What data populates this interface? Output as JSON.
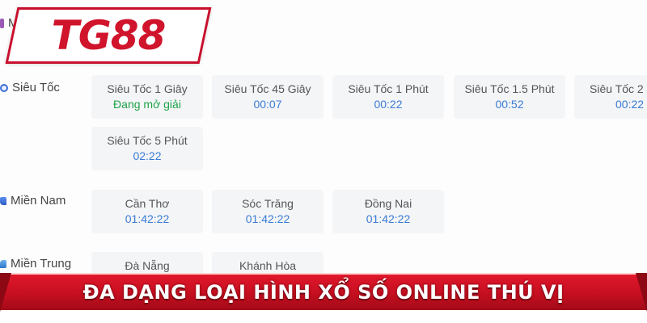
{
  "brand": {
    "logo_text": "TG88"
  },
  "categories": {
    "mega": {
      "label": "Me"
    },
    "sieu_toc": {
      "label": "Siêu Tốc",
      "games": [
        {
          "name": "Siêu Tốc 1 Giây",
          "status": "Đang mở giải"
        },
        {
          "name": "Siêu Tốc 45 Giây",
          "status": "00:07"
        },
        {
          "name": "Siêu Tốc 1 Phút",
          "status": "00:22"
        },
        {
          "name": "Siêu Tốc 1.5 Phút",
          "status": "00:52"
        },
        {
          "name": "Siêu Tốc 2",
          "status": "00:22"
        },
        {
          "name": "Siêu Tốc 5 Phút",
          "status": "02:22"
        }
      ]
    },
    "mien_nam": {
      "label": "Miền Nam",
      "games": [
        {
          "name": "Cần Thơ",
          "status": "01:42:22"
        },
        {
          "name": "Sóc Trăng",
          "status": "01:42:22"
        },
        {
          "name": "Đồng Nai",
          "status": "01:42:22"
        }
      ]
    },
    "mien_trung": {
      "label": "Miền Trung",
      "games": [
        {
          "name": "Đà Nẵng"
        },
        {
          "name": "Khánh Hòa"
        }
      ]
    }
  },
  "banner": {
    "text": "ĐA DẠNG LOẠI HÌNH XỔ SỐ ONLINE THÚ VỊ"
  },
  "colors": {
    "brand_red": "#d0142c",
    "countdown_blue": "#3a7bd5",
    "open_green": "#1fa34a",
    "tile_bg": "#f4f5f7"
  }
}
